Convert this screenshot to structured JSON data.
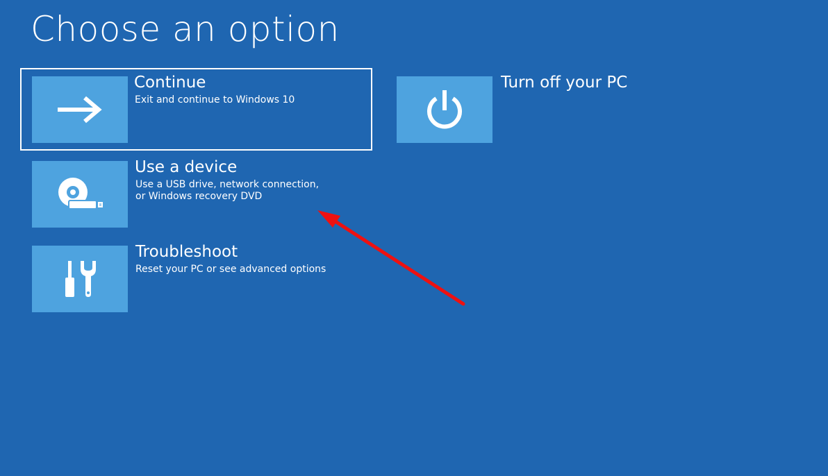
{
  "page": {
    "title": "Choose an option",
    "background_color": "#1f66b1",
    "tile_color": "#4ea3df"
  },
  "options": [
    {
      "key": "continue",
      "title": "Continue",
      "description_lines": [
        "Exit and continue to Windows 10"
      ],
      "icon": "arrow-right-icon",
      "selected": true
    },
    {
      "key": "turn-off",
      "title": "Turn off your PC",
      "description_lines": [],
      "icon": "power-icon",
      "selected": false
    },
    {
      "key": "use-device",
      "title": "Use a device",
      "description_lines": [
        "Use a USB drive, network connection,",
        "or Windows recovery DVD"
      ],
      "icon": "disc-drive-icon",
      "selected": false
    },
    {
      "key": "troubleshoot",
      "title": "Troubleshoot",
      "description_lines": [
        "Reset your PC or see advanced options"
      ],
      "icon": "tools-icon",
      "selected": false
    }
  ],
  "annotation": {
    "icon": "red-arrow-icon",
    "color": "#ee1111",
    "points_to": "use-device"
  }
}
